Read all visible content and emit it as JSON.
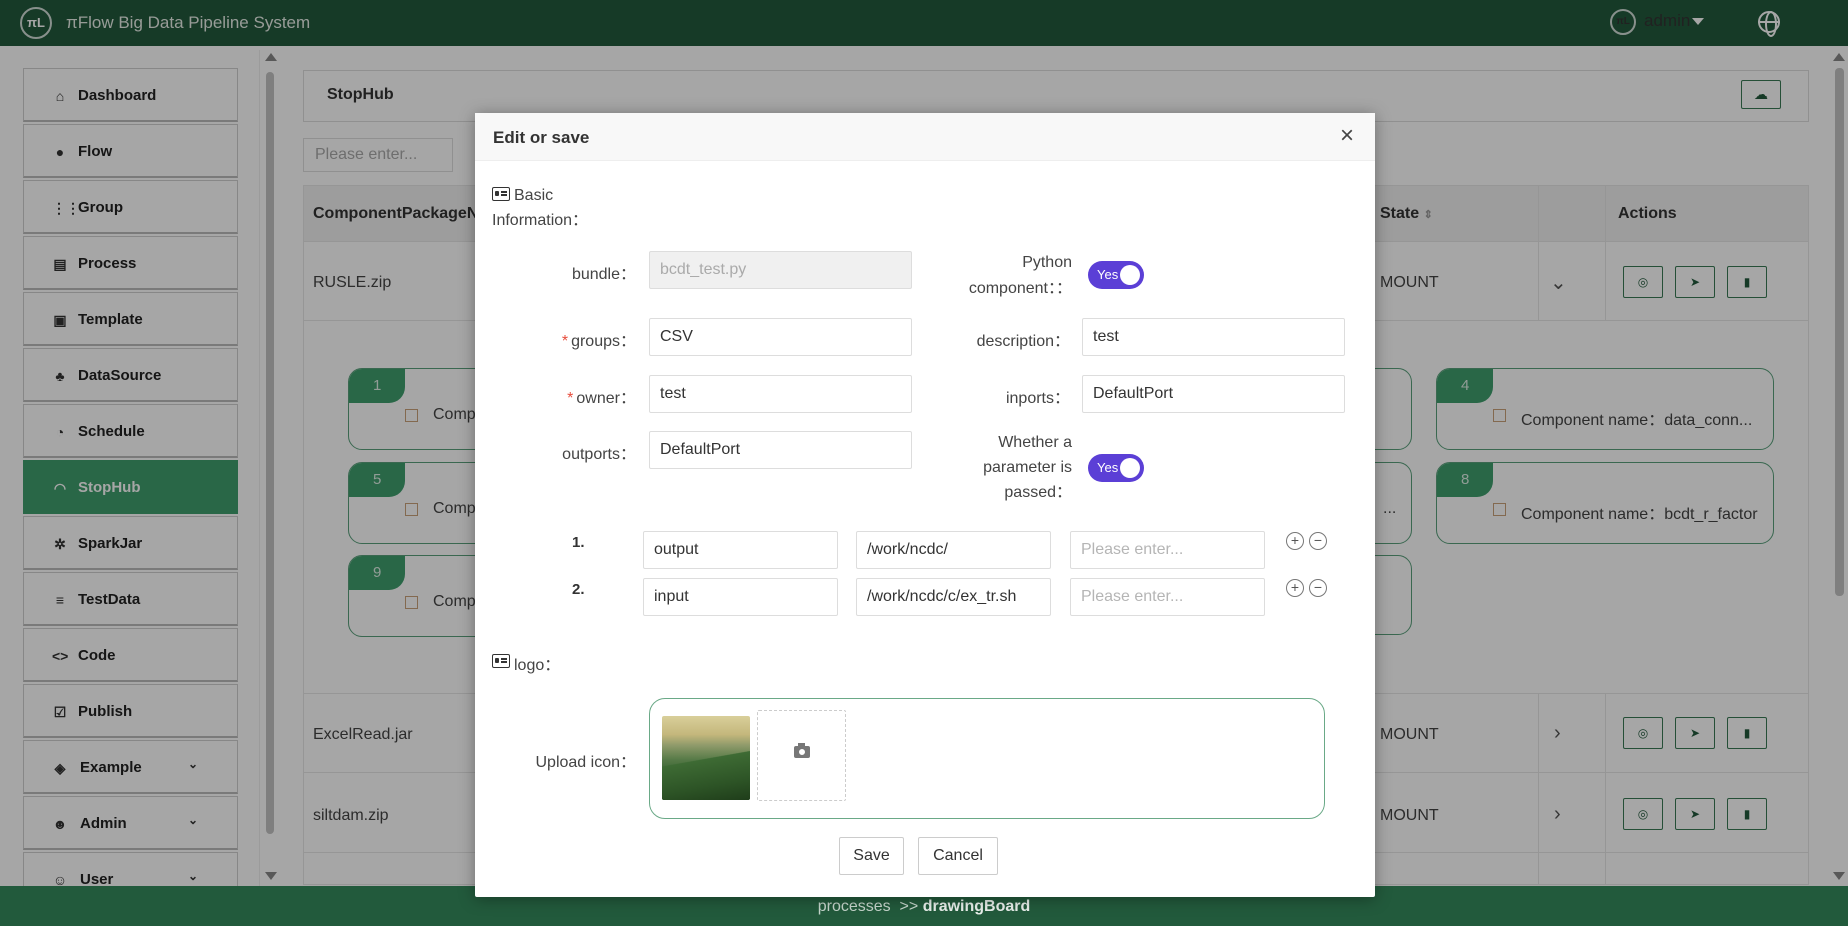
{
  "app": {
    "logo_text": "πL",
    "title": "πFlow Big Data Pipeline System",
    "user": "admin"
  },
  "sidebar": {
    "items": [
      {
        "label": "Dashboard",
        "icon": "home-icon"
      },
      {
        "label": "Flow",
        "icon": "flow-icon"
      },
      {
        "label": "Group",
        "icon": "grid-icon"
      },
      {
        "label": "Process",
        "icon": "chart-icon"
      },
      {
        "label": "Template",
        "icon": "template-icon"
      },
      {
        "label": "DataSource",
        "icon": "datasource-icon"
      },
      {
        "label": "Schedule",
        "icon": "clock-icon"
      },
      {
        "label": "StopHub",
        "icon": "stophub-icon",
        "active": true
      },
      {
        "label": "SparkJar",
        "icon": "gear-icon"
      },
      {
        "label": "TestData",
        "icon": "list-icon"
      },
      {
        "label": "Code",
        "icon": "code-icon"
      },
      {
        "label": "Publish",
        "icon": "check-icon"
      },
      {
        "label": "Example",
        "icon": "cube-icon"
      },
      {
        "label": "Admin",
        "icon": "users-icon"
      },
      {
        "label": "User",
        "icon": "user-icon"
      }
    ]
  },
  "stophub": {
    "title": "StopHub",
    "search_placeholder": "Please enter...",
    "columns": {
      "package": "ComponentPackageN",
      "state": "State",
      "actions": "Actions"
    },
    "rows": [
      {
        "name": "RUSLE.zip",
        "state": "MOUNT"
      },
      {
        "name": "ExcelRead.jar",
        "state": "MOUNT"
      },
      {
        "name": "siltdam.zip",
        "state": "MOUNT"
      }
    ],
    "cards": [
      {
        "num": "1",
        "text": "Compo"
      },
      {
        "num": "4",
        "text": "Component name：data_conn..."
      },
      {
        "num": "5",
        "text": "Compo"
      },
      {
        "num": "8",
        "text": "Component name：bcdt_r_factor"
      },
      {
        "num": "9",
        "text": "Compo"
      }
    ],
    "card_fragment": "..."
  },
  "modal": {
    "title": "Edit or save",
    "close": "×",
    "basic_section": "Basic Information：",
    "bundle_label": "bundle：",
    "bundle_value": "bcdt_test.py",
    "python_label": "Python component：：",
    "python_toggle": "Yes",
    "groups_label": "groups：",
    "groups_value": "CSV",
    "description_label": "description：",
    "description_value": "test",
    "owner_label": "owner：",
    "owner_value": "test",
    "inports_label": "inports：",
    "inports_value": "DefaultPort",
    "outports_label": "outports：",
    "outports_value": "DefaultPort",
    "param_label": "Whether a parameter is passed：",
    "param_toggle": "Yes",
    "params": [
      {
        "num": "1.",
        "name": "output",
        "path": "/work/ncdc/",
        "placeholder": "Please enter..."
      },
      {
        "num": "2.",
        "name": "input",
        "path": "/work/ncdc/c/ex_tr.sh",
        "placeholder": "Please enter..."
      }
    ],
    "logo_section": "logo：",
    "upload_label": "Upload icon：",
    "save": "Save",
    "cancel": "Cancel"
  },
  "footer": {
    "path": "processes  >> ",
    "current": "drawingBoard"
  },
  "colors": {
    "header": "#225a3c",
    "active": "#3f9f6e",
    "toggle": "#5b3fd6"
  }
}
